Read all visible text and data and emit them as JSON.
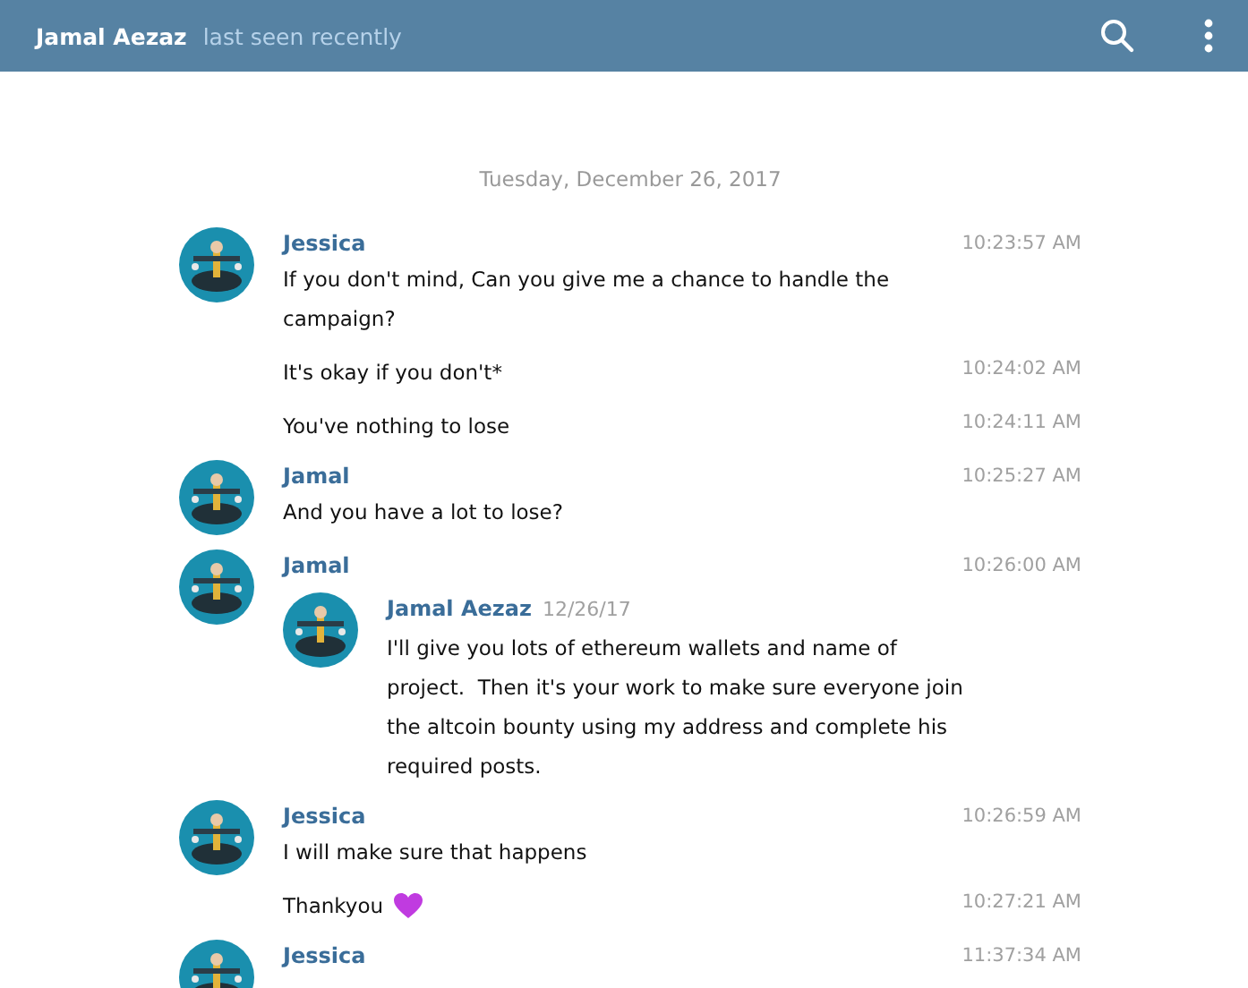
{
  "header": {
    "title": "Jamal Aezaz",
    "status": "last seen recently"
  },
  "date": "Tuesday, December 26, 2017",
  "groups": [
    {
      "sender": "Jessica",
      "messages": [
        {
          "kind": "text",
          "text": "If you don't mind, Can you give me a chance to handle the campaign?",
          "time": "10:23:57 AM"
        },
        {
          "kind": "text",
          "text": "It's okay if you don't*",
          "time": "10:24:02 AM"
        },
        {
          "kind": "text",
          "text": "You've nothing to lose",
          "time": "10:24:11 AM"
        }
      ]
    },
    {
      "sender": "Jamal",
      "messages": [
        {
          "kind": "text",
          "text": "And you have a lot to lose?",
          "time": "10:25:27 AM"
        }
      ]
    },
    {
      "sender": "Jamal",
      "messages": [
        {
          "kind": "forward",
          "time": "10:26:00 AM",
          "forward": {
            "name": "Jamal Aezaz",
            "date": "12/26/17",
            "text": "I'll give you lots of ethereum wallets and name of project.  Then it's your work to make sure everyone join the altcoin bounty using my address and complete his required posts."
          }
        }
      ]
    },
    {
      "sender": "Jessica",
      "messages": [
        {
          "kind": "text",
          "text": "I will make sure that happens",
          "time": "10:26:59 AM"
        },
        {
          "kind": "heart",
          "text": "Thankyou",
          "time": "10:27:21 AM"
        }
      ]
    },
    {
      "sender": "Jessica",
      "time": "11:37:34 AM"
    }
  ]
}
